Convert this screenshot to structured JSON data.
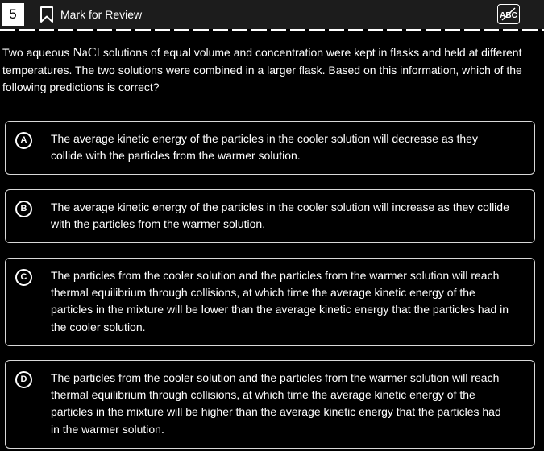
{
  "header": {
    "question_number": "5",
    "mark_label": "Mark for Review",
    "abc_label": "ABC",
    "icons": [
      "bookmark-icon",
      "abc-strikethrough-icon"
    ]
  },
  "question": {
    "before": "Two aqueous ",
    "chem": "NaCl",
    "after": " solutions of equal volume and concentration were kept in flasks and held at different temperatures. The two solutions were combined in a larger flask. Based on this information, which of the following predictions is correct?"
  },
  "options": [
    {
      "letter": "A",
      "text": "The average kinetic energy of the particles in the cooler solution will decrease as they collide with the particles from the warmer solution."
    },
    {
      "letter": "B",
      "text": "The average kinetic energy of the particles in the cooler solution will increase as they collide with the particles from the warmer solution."
    },
    {
      "letter": "C",
      "text": "The particles from the cooler solution and the particles from the warmer solution will reach thermal equilibrium through collisions, at which time the average kinetic energy of the particles in the mixture will be lower than the average kinetic energy that the particles had in the cooler solution."
    },
    {
      "letter": "D",
      "text": "The particles from the cooler solution and the particles from the warmer solution will reach thermal equilibrium through collisions, at which time the average kinetic energy of the particles in the mixture will be higher than the average kinetic energy that the particles had in the warmer solution."
    }
  ]
}
